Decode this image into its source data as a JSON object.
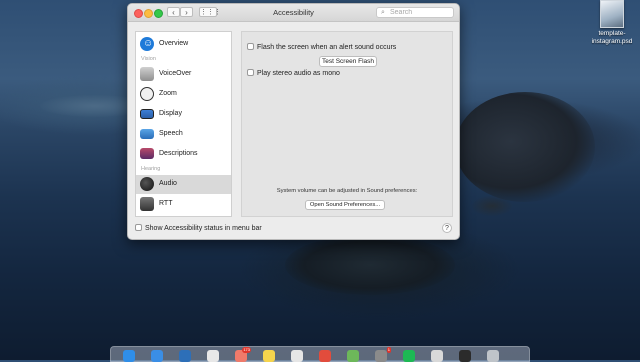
{
  "desktop": {
    "file_name": "template-instagram.psd"
  },
  "window": {
    "title": "Accessibility",
    "search_placeholder": "Search",
    "nav": {
      "back": "‹",
      "forward": "›",
      "grid": "⋮⋮⋮"
    }
  },
  "sidebar": {
    "items": [
      {
        "label": "Overview",
        "icon": "overview-icon",
        "selected": false
      },
      {
        "label": "VoiceOver",
        "icon": "voiceover-icon",
        "selected": false
      },
      {
        "label": "Zoom",
        "icon": "zoom-icon",
        "selected": false
      },
      {
        "label": "Display",
        "icon": "display-icon",
        "selected": false
      },
      {
        "label": "Speech",
        "icon": "speech-icon",
        "selected": false
      },
      {
        "label": "Descriptions",
        "icon": "descriptions-icon",
        "selected": false
      },
      {
        "label": "Audio",
        "icon": "audio-icon",
        "selected": true
      },
      {
        "label": "RTT",
        "icon": "rtt-icon",
        "selected": false
      }
    ],
    "headers": {
      "vision": "Vision",
      "hearing": "Hearing"
    }
  },
  "panel": {
    "flash_label": "Flash the screen when an alert sound occurs",
    "flash_checked": false,
    "test_flash_button": "Test Screen Flash",
    "mono_label": "Play stereo audio as mono",
    "mono_checked": false,
    "info_text": "System volume can be adjusted in Sound preferences:",
    "open_sound_button": "Open Sound Preferences..."
  },
  "footer": {
    "status_label": "Show Accessibility status in menu bar",
    "status_checked": false,
    "help": "?"
  },
  "dock": {
    "apps": [
      {
        "name": "finder",
        "color": "#2f8ee8"
      },
      {
        "name": "safari",
        "color": "#3a8ee6"
      },
      {
        "name": "mail-app",
        "color": "#2d6fb8"
      },
      {
        "name": "calendar",
        "color": "#e8e8e8"
      },
      {
        "name": "photos",
        "color": "#f07a6a",
        "badge": "173"
      },
      {
        "name": "notes",
        "color": "#f6d44c"
      },
      {
        "name": "slack",
        "color": "#e6e6e6"
      },
      {
        "name": "chrome",
        "color": "#e24c3c"
      },
      {
        "name": "color-app",
        "color": "#6db85a"
      },
      {
        "name": "system-preferences",
        "color": "#8b8b8b",
        "badge": "1"
      },
      {
        "name": "spotify",
        "color": "#1db954"
      },
      {
        "name": "preview",
        "color": "#d9d9d9"
      },
      {
        "name": "terminal",
        "color": "#2b2b2b"
      },
      {
        "name": "trash",
        "color": "#bfc4c9"
      }
    ]
  }
}
